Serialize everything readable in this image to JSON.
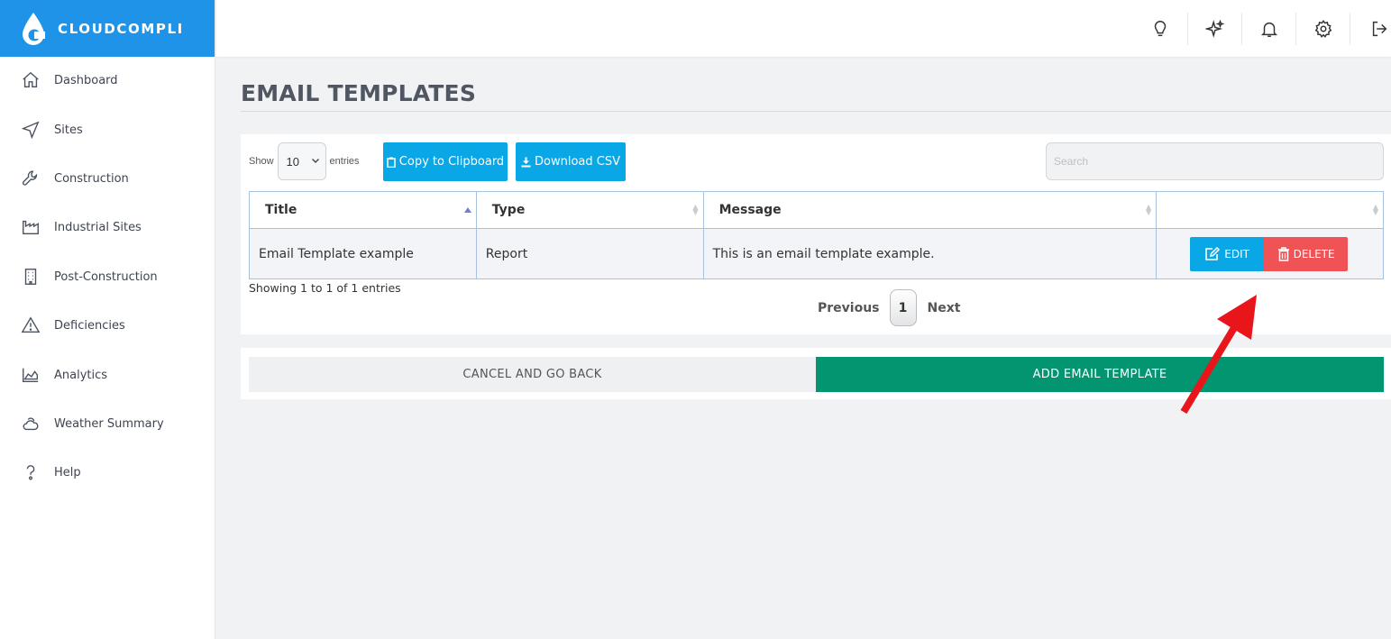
{
  "brand": {
    "name": "CLOUDCOMPLI"
  },
  "sidebar": {
    "items": [
      {
        "label": "Dashboard",
        "icon": "home-icon"
      },
      {
        "label": "Sites",
        "icon": "navigation-arrow-icon"
      },
      {
        "label": "Construction",
        "icon": "wrench-icon"
      },
      {
        "label": "Industrial Sites",
        "icon": "factory-icon"
      },
      {
        "label": "Post-Construction",
        "icon": "building-icon"
      },
      {
        "label": "Deficiencies",
        "icon": "warning-icon"
      },
      {
        "label": "Analytics",
        "icon": "area-chart-icon"
      },
      {
        "label": "Weather Summary",
        "icon": "cloud-sun-icon"
      },
      {
        "label": "Help",
        "icon": "question-icon"
      }
    ]
  },
  "topbar": {
    "icons": [
      "lightbulb-icon",
      "sparkles-icon",
      "bell-icon",
      "gear-icon",
      "logout-icon"
    ]
  },
  "page": {
    "title": "EMAIL TEMPLATES"
  },
  "table_controls": {
    "show_label": "Show",
    "entries_value": "10",
    "entries_label": "entries",
    "copy_button": "Copy to Clipboard",
    "csv_button": "Download CSV",
    "search_placeholder": "Search"
  },
  "table": {
    "columns": [
      "Title",
      "Type",
      "Message",
      ""
    ],
    "rows": [
      {
        "title": "Email Template example",
        "type": "Report",
        "message": "This is an email template example.",
        "edit": "EDIT",
        "delete": "DELETE"
      }
    ],
    "info": "Showing 1 to 1 of 1 entries",
    "pagination": {
      "previous": "Previous",
      "current": "1",
      "next": "Next"
    }
  },
  "actions": {
    "cancel": "CANCEL AND GO BACK",
    "add": "ADD EMAIL TEMPLATE"
  },
  "colors": {
    "brand_blue": "#1f93e8",
    "button_blue": "#0aa7e6",
    "delete_red": "#ef5356",
    "add_green": "#039570",
    "annotation_arrow": "#e8151b"
  }
}
